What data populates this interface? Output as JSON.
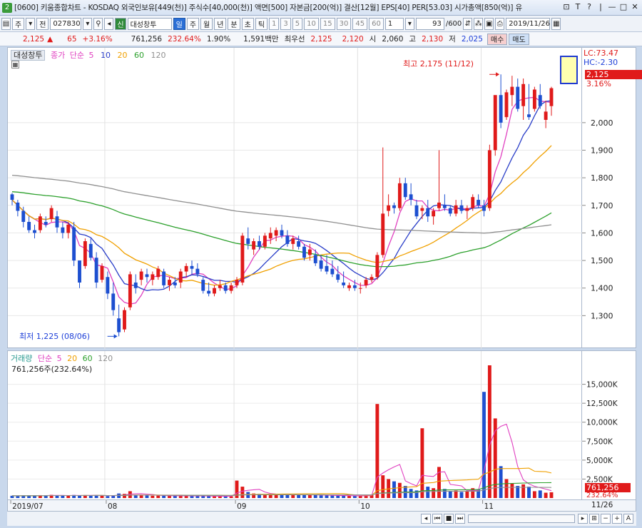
{
  "window": {
    "num": "2",
    "title": "[0600] 키움종합차트 - KOSDAQ 외국인보유[449(천)] 주식수[40,000(천)] 액면[500] 자본금[200(억)] 결산[12월] EPS[40] PER[53.03] 시가총액[850(억)] 유",
    "controls": [
      "⊡",
      "T",
      "?",
      "|",
      "—",
      "□",
      "✕"
    ]
  },
  "toolbar": {
    "period_label": "주",
    "market_label": "전",
    "code": "027830",
    "stock_name": "대성창투",
    "stock_badge": "신",
    "periods": [
      "일",
      "주",
      "월",
      "년",
      "분",
      "초",
      "틱"
    ],
    "selected_period": "일",
    "minutes": [
      "1",
      "3",
      "5",
      "10",
      "15",
      "30",
      "45",
      "60"
    ],
    "unit": "1",
    "count": "93",
    "count_total": "/600",
    "date": "2019/11/26"
  },
  "quote": {
    "price": "2,125",
    "arrow": "▲",
    "change": "65",
    "change_pct": "+3.16%",
    "volume": "761,256",
    "vol_ratio": "232.64%",
    "turnover": "1.90%",
    "amount": "1,591백만",
    "best_label": "최우선",
    "best_ask": "2,125",
    "best_bid": "2,120",
    "open_label": "시",
    "open": "2,060",
    "high_label": "고",
    "high": "2,130",
    "low_label": "저",
    "low": "2,025",
    "buy_label": "매수",
    "sell_label": "매도"
  },
  "price_legend": {
    "name": "대성창투",
    "close_label": "종가",
    "ma_label": "단순",
    "ma": [
      "5",
      "10",
      "20",
      "60",
      "120"
    ]
  },
  "vol_legend": {
    "name": "거래량",
    "ma_label": "단순",
    "ma": [
      "5",
      "20",
      "60",
      "120"
    ],
    "value": "761,256주(232.64%)"
  },
  "annotations": {
    "high": "최고 2,175 (11/12)",
    "low": "최저 1,225 (08/06)"
  },
  "scale": {
    "lc": "LC:73.47",
    "hc": "HC:-2.30",
    "current_price": "2,125",
    "current_pct": "3.16%",
    "current_vol": "761,256",
    "current_vol_pct": "232.64%",
    "end_date": "11/26"
  },
  "colors": {
    "up": "#e01a1a",
    "down": "#1d4fd0",
    "ma5": "#e040c0",
    "ma10": "#2a3ec8",
    "ma20": "#f0a000",
    "ma60": "#2ca02c",
    "ma120": "#909090"
  },
  "chart_data": {
    "type": "candlestick",
    "x_labels": [
      "2019/07",
      "08",
      "09",
      "10",
      "11"
    ],
    "y_ticks": [
      "1,300",
      "1,400",
      "1,500",
      "1,600",
      "1,700",
      "1,800",
      "1,900",
      "2,000"
    ],
    "ylim": [
      1200,
      2230
    ],
    "vol_ticks": [
      "2,500K",
      "5,000K",
      "7,500K",
      "10,000K",
      "12,500K",
      "15,000K"
    ],
    "vol_lim": [
      0,
      17500
    ],
    "month_start_index": [
      0,
      17,
      40,
      62,
      84
    ],
    "ohlc": [
      [
        1740,
        1745,
        1700,
        1720
      ],
      [
        1710,
        1720,
        1660,
        1680
      ],
      [
        1680,
        1695,
        1620,
        1640
      ],
      [
        1640,
        1660,
        1600,
        1610
      ],
      [
        1610,
        1630,
        1580,
        1600
      ],
      [
        1610,
        1670,
        1600,
        1660
      ],
      [
        1640,
        1660,
        1620,
        1630
      ],
      [
        1650,
        1700,
        1640,
        1690
      ],
      [
        1660,
        1680,
        1600,
        1620
      ],
      [
        1620,
        1640,
        1580,
        1600
      ],
      [
        1600,
        1640,
        1580,
        1630
      ],
      [
        1620,
        1640,
        1480,
        1500
      ],
      [
        1500,
        1500,
        1400,
        1420
      ],
      [
        1480,
        1580,
        1470,
        1570
      ],
      [
        1560,
        1580,
        1500,
        1510
      ],
      [
        1510,
        1530,
        1400,
        1420
      ],
      [
        1430,
        1490,
        1420,
        1480
      ],
      [
        1440,
        1460,
        1360,
        1380
      ],
      [
        1380,
        1420,
        1300,
        1320
      ],
      [
        1290,
        1340,
        1225,
        1240
      ],
      [
        1250,
        1330,
        1240,
        1320
      ],
      [
        1330,
        1460,
        1320,
        1450
      ],
      [
        1420,
        1450,
        1380,
        1400
      ],
      [
        1430,
        1470,
        1410,
        1460
      ],
      [
        1450,
        1470,
        1420,
        1440
      ],
      [
        1430,
        1460,
        1410,
        1450
      ],
      [
        1440,
        1480,
        1430,
        1470
      ],
      [
        1460,
        1470,
        1400,
        1410
      ],
      [
        1410,
        1440,
        1390,
        1430
      ],
      [
        1420,
        1440,
        1400,
        1410
      ],
      [
        1420,
        1470,
        1400,
        1460
      ],
      [
        1460,
        1490,
        1440,
        1480
      ],
      [
        1480,
        1500,
        1450,
        1470
      ],
      [
        1470,
        1490,
        1440,
        1450
      ],
      [
        1430,
        1440,
        1380,
        1390
      ],
      [
        1390,
        1420,
        1370,
        1380
      ],
      [
        1380,
        1410,
        1370,
        1400
      ],
      [
        1400,
        1430,
        1390,
        1410
      ],
      [
        1410,
        1420,
        1380,
        1390
      ],
      [
        1390,
        1420,
        1380,
        1410
      ],
      [
        1410,
        1440,
        1400,
        1430
      ],
      [
        1420,
        1600,
        1410,
        1590
      ],
      [
        1580,
        1620,
        1540,
        1560
      ],
      [
        1540,
        1580,
        1520,
        1570
      ],
      [
        1570,
        1590,
        1540,
        1550
      ],
      [
        1550,
        1600,
        1540,
        1590
      ],
      [
        1580,
        1620,
        1560,
        1600
      ],
      [
        1590,
        1620,
        1570,
        1610
      ],
      [
        1610,
        1630,
        1580,
        1590
      ],
      [
        1590,
        1610,
        1550,
        1560
      ],
      [
        1560,
        1590,
        1540,
        1580
      ],
      [
        1570,
        1590,
        1540,
        1550
      ],
      [
        1550,
        1560,
        1500,
        1510
      ],
      [
        1520,
        1560,
        1500,
        1540
      ],
      [
        1520,
        1540,
        1480,
        1490
      ],
      [
        1500,
        1520,
        1460,
        1470
      ],
      [
        1480,
        1520,
        1450,
        1460
      ],
      [
        1470,
        1500,
        1440,
        1450
      ],
      [
        1450,
        1480,
        1420,
        1430
      ],
      [
        1420,
        1460,
        1400,
        1410
      ],
      [
        1400,
        1420,
        1390,
        1410
      ],
      [
        1410,
        1430,
        1390,
        1400
      ],
      [
        1400,
        1420,
        1380,
        1400
      ],
      [
        1410,
        1440,
        1400,
        1430
      ],
      [
        1430,
        1450,
        1420,
        1440
      ],
      [
        1440,
        1530,
        1430,
        1520
      ],
      [
        1520,
        1910,
        1510,
        1670
      ],
      [
        1680,
        1740,
        1660,
        1700
      ],
      [
        1700,
        1710,
        1670,
        1690
      ],
      [
        1690,
        1800,
        1680,
        1780
      ],
      [
        1780,
        1800,
        1720,
        1730
      ],
      [
        1740,
        1780,
        1700,
        1720
      ],
      [
        1700,
        1720,
        1650,
        1660
      ],
      [
        1680,
        1700,
        1650,
        1690
      ],
      [
        1690,
        1720,
        1640,
        1660
      ],
      [
        1660,
        1690,
        1630,
        1680
      ],
      [
        1690,
        1900,
        1680,
        1710
      ],
      [
        1700,
        1740,
        1680,
        1690
      ],
      [
        1690,
        1700,
        1660,
        1670
      ],
      [
        1670,
        1720,
        1660,
        1700
      ],
      [
        1700,
        1720,
        1670,
        1680
      ],
      [
        1680,
        1700,
        1650,
        1690
      ],
      [
        1690,
        1740,
        1680,
        1730
      ],
      [
        1720,
        1740,
        1690,
        1700
      ],
      [
        1700,
        1720,
        1660,
        1680
      ],
      [
        1690,
        1920,
        1680,
        1900
      ],
      [
        1900,
        2080,
        1880,
        2100
      ],
      [
        2100,
        2175,
        1980,
        2000
      ],
      [
        2020,
        2120,
        2010,
        2110
      ],
      [
        2100,
        2170,
        2060,
        2130
      ],
      [
        2130,
        2160,
        2040,
        2050
      ],
      [
        2060,
        2160,
        2010,
        2140
      ],
      [
        2030,
        2140,
        2010,
        2020
      ],
      [
        2050,
        2130,
        2040,
        2120
      ],
      [
        2100,
        2140,
        2050,
        2060
      ],
      [
        2010,
        2080,
        1980,
        2040
      ],
      [
        2060,
        2130,
        2025,
        2125
      ]
    ],
    "volume": [
      300,
      280,
      320,
      350,
      300,
      380,
      300,
      420,
      330,
      300,
      310,
      400,
      340,
      350,
      320,
      380,
      300,
      260,
      300,
      600,
      550,
      900,
      420,
      380,
      350,
      300,
      320,
      300,
      280,
      300,
      300,
      320,
      280,
      250,
      260,
      240,
      230,
      250,
      220,
      240,
      2300,
      1500,
      800,
      600,
      550,
      500,
      520,
      480,
      450,
      400,
      420,
      400,
      450,
      380,
      400,
      350,
      330,
      320,
      300,
      300,
      290,
      280,
      300,
      350,
      400,
      12400,
      3000,
      2500,
      2200,
      2000,
      1600,
      1200,
      1000,
      9200,
      1500,
      1300,
      4100,
      1200,
      900,
      1000,
      800,
      900,
      1300,
      1100,
      14000,
      17500,
      10500,
      4200,
      2500,
      1900,
      1600,
      1800,
      1500,
      900,
      1000,
      700,
      761
    ],
    "series": [
      {
        "name": "5",
        "color": "#e040c0"
      },
      {
        "name": "10",
        "color": "#2a3ec8"
      },
      {
        "name": "20",
        "color": "#f0a000"
      },
      {
        "name": "60",
        "color": "#2ca02c"
      },
      {
        "name": "120",
        "color": "#909090"
      }
    ]
  }
}
